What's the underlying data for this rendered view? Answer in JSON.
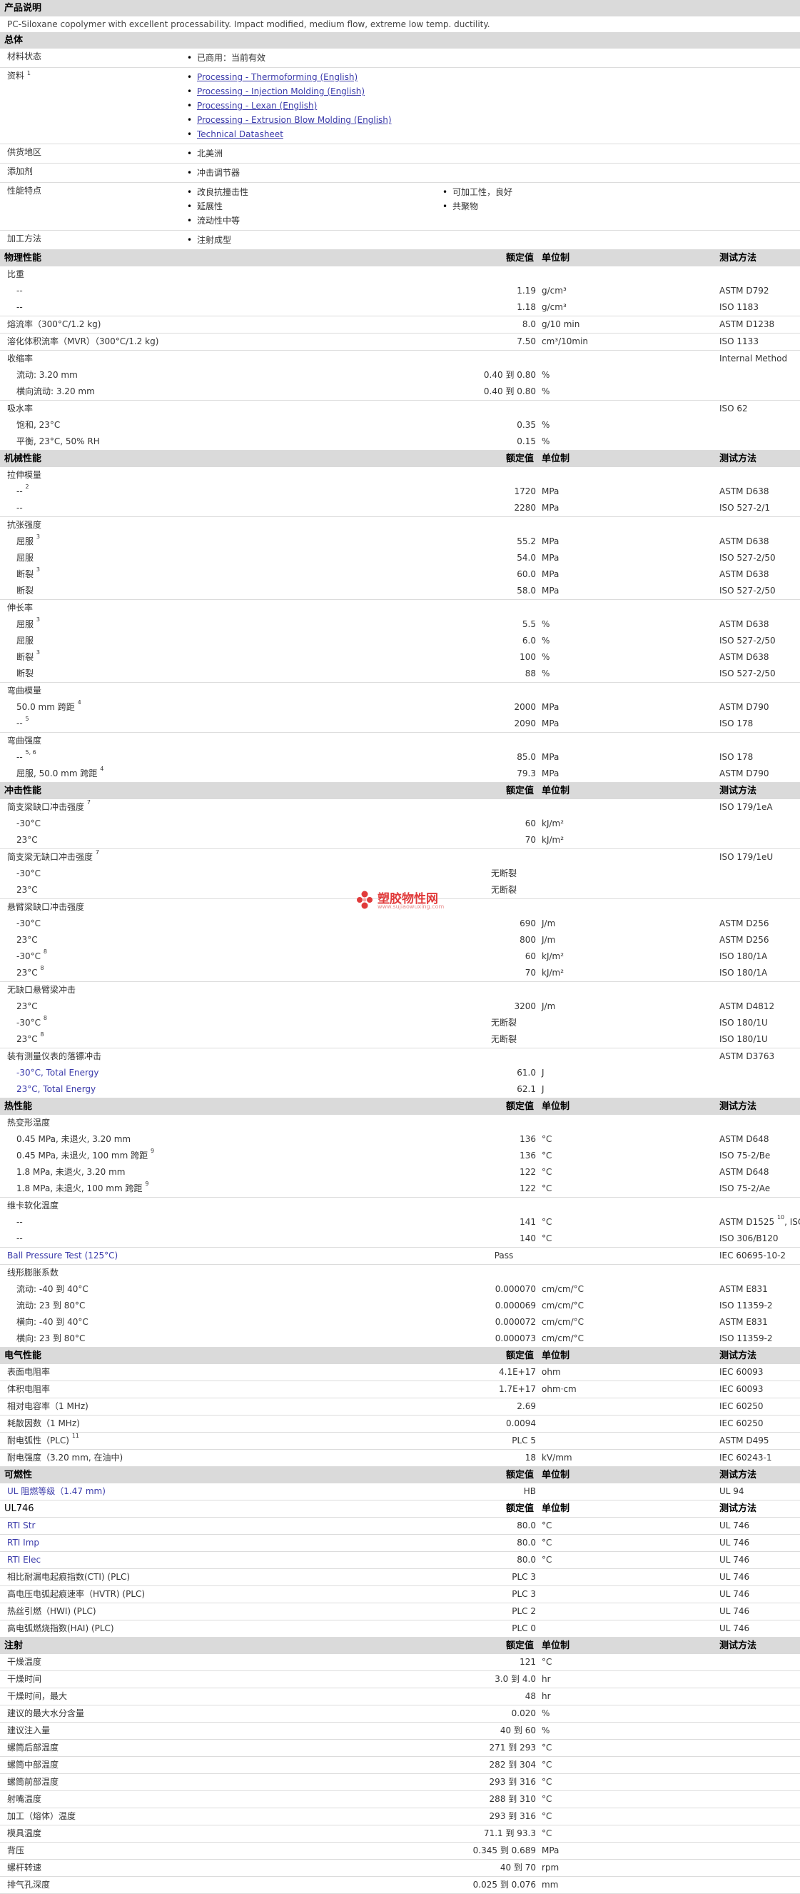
{
  "product_desc": {
    "title": "产品说明",
    "text": "PC-Siloxane copolymer with excellent processability. Impact modified, medium flow, extreme low temp. ductility."
  },
  "general": {
    "title": "总体",
    "rows": [
      {
        "label": "材料状态",
        "items": [
          "已商用：当前有效"
        ]
      },
      {
        "label": "资料",
        "sup": "1",
        "links": [
          "Processing - Thermoforming (English)",
          "Processing - Injection Molding (English)",
          "Processing - Lexan (English)",
          "Processing - Extrusion Blow Molding (English)",
          "Technical Datasheet"
        ]
      },
      {
        "label": "供货地区",
        "items": [
          "北美洲"
        ]
      },
      {
        "label": "添加剂",
        "items": [
          "冲击调节器"
        ]
      },
      {
        "label": "性能特点",
        "items": [
          "改良抗撞击性",
          "可加工性，良好",
          "延展性",
          "共聚物",
          "流动性中等"
        ]
      },
      {
        "label": "加工方法",
        "items": [
          "注射成型"
        ]
      }
    ]
  },
  "headers": {
    "nominal": "额定值",
    "unit": "单位制",
    "method": "测试方法"
  },
  "sections": [
    {
      "title": "物理性能",
      "groups": [
        {
          "label": "比重",
          "rows": [
            {
              "label": "--",
              "val": "1.19",
              "unit": "g/cm³",
              "mth": "ASTM D792"
            },
            {
              "label": "--",
              "val": "1.18",
              "unit": "g/cm³",
              "mth": "ISO 1183"
            }
          ]
        },
        {
          "rows": [
            {
              "label": "熔流率（300°C/1.2 kg)",
              "top": true,
              "val": "8.0",
              "unit": "g/10 min",
              "mth": "ASTM D1238"
            }
          ]
        },
        {
          "rows": [
            {
              "label": "溶化体积流率（MVR）（300°C/1.2 kg)",
              "top": true,
              "val": "7.50",
              "unit": "cm³/10min",
              "mth": "ISO 1133"
            }
          ]
        },
        {
          "label": "收缩率",
          "labelmth": "Internal Method",
          "rows": [
            {
              "label": "流动: 3.20 mm",
              "val": "0.40 到  0.80",
              "unit": "%",
              "mth": ""
            },
            {
              "label": "横向流动: 3.20 mm",
              "val": "0.40 到  0.80",
              "unit": "%",
              "mth": ""
            }
          ]
        },
        {
          "label": "吸水率",
          "labelmth": "ISO 62",
          "rows": [
            {
              "label": "饱和, 23°C",
              "val": "0.35",
              "unit": "%",
              "mth": ""
            },
            {
              "label": "平衡, 23°C, 50% RH",
              "val": "0.15",
              "unit": "%",
              "mth": ""
            }
          ]
        }
      ]
    },
    {
      "title": "机械性能",
      "groups": [
        {
          "label": "拉伸模量",
          "rows": [
            {
              "label": "--",
              "sup": "2",
              "val": "1720",
              "unit": "MPa",
              "mth": "ASTM D638"
            },
            {
              "label": "--",
              "val": "2280",
              "unit": "MPa",
              "mth": "ISO 527-2/1"
            }
          ]
        },
        {
          "label": "抗张强度",
          "rows": [
            {
              "label": "屈服",
              "sup": "3",
              "val": "55.2",
              "unit": "MPa",
              "mth": "ASTM D638"
            },
            {
              "label": "屈服",
              "val": "54.0",
              "unit": "MPa",
              "mth": "ISO 527-2/50"
            },
            {
              "label": "断裂",
              "sup": "3",
              "val": "60.0",
              "unit": "MPa",
              "mth": "ASTM D638"
            },
            {
              "label": "断裂",
              "val": "58.0",
              "unit": "MPa",
              "mth": "ISO 527-2/50"
            }
          ]
        },
        {
          "label": "伸长率",
          "rows": [
            {
              "label": "屈服",
              "sup": "3",
              "val": "5.5",
              "unit": "%",
              "mth": "ASTM D638"
            },
            {
              "label": "屈服",
              "val": "6.0",
              "unit": "%",
              "mth": "ISO 527-2/50"
            },
            {
              "label": "断裂",
              "sup": "3",
              "val": "100",
              "unit": "%",
              "mth": "ASTM D638"
            },
            {
              "label": "断裂",
              "val": "88",
              "unit": "%",
              "mth": "ISO 527-2/50"
            }
          ]
        },
        {
          "label": "弯曲模量",
          "rows": [
            {
              "label": "50.0 mm 跨距",
              "sup": "4",
              "val": "2000",
              "unit": "MPa",
              "mth": "ASTM D790"
            },
            {
              "label": "--",
              "sup": "5",
              "val": "2090",
              "unit": "MPa",
              "mth": "ISO 178"
            }
          ]
        },
        {
          "label": "弯曲强度",
          "rows": [
            {
              "label": "--",
              "sup": "5, 6",
              "val": "85.0",
              "unit": "MPa",
              "mth": "ISO 178"
            },
            {
              "label": "屈服, 50.0 mm 跨距",
              "sup": "4",
              "val": "79.3",
              "unit": "MPa",
              "mth": "ASTM D790"
            }
          ]
        }
      ]
    },
    {
      "title": "冲击性能",
      "groups": [
        {
          "label": "简支梁缺口冲击强度",
          "labelsup": "7",
          "labelmth": "ISO 179/1eA",
          "rows": [
            {
              "label": "-30°C",
              "val": "60",
              "unit": "kJ/m²",
              "mth": ""
            },
            {
              "label": "23°C",
              "val": "70",
              "unit": "kJ/m²",
              "mth": ""
            }
          ]
        },
        {
          "label": "简支梁无缺口冲击强度",
          "labelsup": "7",
          "labelmth": "ISO 179/1eU",
          "rows": [
            {
              "label": "-30°C",
              "val": "无断裂",
              "center": true,
              "unit": "",
              "mth": ""
            },
            {
              "label": "23°C",
              "val": "无断裂",
              "center": true,
              "unit": "",
              "mth": ""
            }
          ]
        },
        {
          "label": "悬臂梁缺口冲击强度",
          "rows": [
            {
              "label": "-30°C",
              "val": "690",
              "unit": "J/m",
              "mth": "ASTM D256"
            },
            {
              "label": "23°C",
              "val": "800",
              "unit": "J/m",
              "mth": "ASTM D256"
            },
            {
              "label": "-30°C",
              "sup": "8",
              "val": "60",
              "unit": "kJ/m²",
              "mth": "ISO 180/1A"
            },
            {
              "label": "23°C",
              "sup": "8",
              "val": "70",
              "unit": "kJ/m²",
              "mth": "ISO 180/1A"
            }
          ]
        },
        {
          "label": "无缺口悬臂梁冲击",
          "rows": [
            {
              "label": "23°C",
              "val": "3200",
              "unit": "J/m",
              "mth": "ASTM D4812"
            },
            {
              "label": "-30°C",
              "sup": "8",
              "val": "无断裂",
              "center": true,
              "unit": "",
              "mth": "ISO 180/1U"
            },
            {
              "label": "23°C",
              "sup": "8",
              "val": "无断裂",
              "center": true,
              "unit": "",
              "mth": "ISO 180/1U"
            }
          ]
        },
        {
          "label": "装有测量仪表的落镖冲击",
          "labelmth": "ASTM D3763",
          "rows": [
            {
              "label": "-30°C, Total Energy",
              "link": true,
              "val": "61.0",
              "unit": "J",
              "mth": ""
            },
            {
              "label": "23°C, Total Energy",
              "link": true,
              "val": "62.1",
              "unit": "J",
              "mth": ""
            }
          ]
        }
      ]
    },
    {
      "title": "热性能",
      "groups": [
        {
          "label": "热变形温度",
          "rows": [
            {
              "label": "0.45 MPa, 未退火, 3.20 mm",
              "val": "136",
              "unit": "°C",
              "mth": "ASTM D648"
            },
            {
              "label": "0.45 MPa, 未退火, 100 mm 跨距",
              "sup": "9",
              "val": "136",
              "unit": "°C",
              "mth": "ISO 75-2/Be"
            },
            {
              "label": "1.8 MPa, 未退火, 3.20 mm",
              "val": "122",
              "unit": "°C",
              "mth": "ASTM D648"
            },
            {
              "label": "1.8 MPa, 未退火, 100 mm 跨距",
              "sup": "9",
              "val": "122",
              "unit": "°C",
              "mth": "ISO 75-2/Ae"
            }
          ]
        },
        {
          "label": "维卡软化温度",
          "rows": [
            {
              "label": "--",
              "val": "141",
              "unit": "°C",
              "mth": "ASTM D1525",
              "mthsup": "10",
              "mthtail": ", ISO"
            },
            {
              "label": "--",
              "val": "140",
              "unit": "°C",
              "mth": "ISO 306/B120"
            }
          ]
        },
        {
          "rows": [
            {
              "label": "Ball Pressure Test (125°C)",
              "top": true,
              "link": true,
              "val": "Pass",
              "center": true,
              "unit": "",
              "mth": "IEC 60695-10-2"
            }
          ]
        },
        {
          "label": "线形膨胀系数",
          "rows": [
            {
              "label": "流动: -40 到  40°C",
              "val": "0.000070",
              "unit": "cm/cm/°C",
              "mth": "ASTM E831"
            },
            {
              "label": "流动: 23 到  80°C",
              "val": "0.000069",
              "unit": "cm/cm/°C",
              "mth": "ISO 11359-2"
            },
            {
              "label": "横向: -40 到  40°C",
              "val": "0.000072",
              "unit": "cm/cm/°C",
              "mth": "ASTM E831"
            },
            {
              "label": "横向: 23 到  80°C",
              "val": "0.000073",
              "unit": "cm/cm/°C",
              "mth": "ISO 11359-2"
            }
          ]
        }
      ]
    },
    {
      "title": "电气性能",
      "groups": [
        {
          "rows": [
            {
              "label": "表面电阻率",
              "top": true,
              "val": "4.1E+17",
              "unit": "ohm",
              "mth": "IEC 60093"
            }
          ]
        },
        {
          "rows": [
            {
              "label": "体积电阻率",
              "top": true,
              "val": "1.7E+17",
              "unit": "ohm·cm",
              "mth": "IEC 60093"
            }
          ]
        },
        {
          "rows": [
            {
              "label": "相对电容率（1 MHz)",
              "top": true,
              "val": "2.69",
              "unit": "",
              "mth": "IEC 60250"
            }
          ]
        },
        {
          "rows": [
            {
              "label": "耗散因数（1 MHz)",
              "top": true,
              "val": "0.0094",
              "unit": "",
              "mth": "IEC 60250"
            }
          ]
        },
        {
          "rows": [
            {
              "label": "耐电弧性（PLC)",
              "sup": "11",
              "top": true,
              "val": "PLC 5",
              "unit": "",
              "mth": "ASTM D495"
            }
          ]
        },
        {
          "rows": [
            {
              "label": "耐电强度（3.20 mm, 在油中)",
              "top": true,
              "val": "18",
              "unit": "kV/mm",
              "mth": "IEC 60243-1"
            }
          ]
        }
      ]
    },
    {
      "title": "可燃性",
      "groups": [
        {
          "rows": [
            {
              "label": "UL 阻燃等级（1.47 mm)",
              "top": true,
              "link": true,
              "val": "HB",
              "unit": "",
              "mth": "UL 94"
            }
          ]
        }
      ]
    },
    {
      "title": "UL746",
      "plain": true,
      "groups": [
        {
          "rows": [
            {
              "label": "RTI Str",
              "top": true,
              "link": true,
              "val": "80.0",
              "unit": "°C",
              "mth": "UL 746"
            }
          ]
        },
        {
          "rows": [
            {
              "label": "RTI Imp",
              "top": true,
              "link": true,
              "val": "80.0",
              "unit": "°C",
              "mth": "UL 746"
            }
          ]
        },
        {
          "rows": [
            {
              "label": "RTI Elec",
              "top": true,
              "link": true,
              "val": "80.0",
              "unit": "°C",
              "mth": "UL 746"
            }
          ]
        },
        {
          "rows": [
            {
              "label": "相比耐漏电起痕指数(CTI) (PLC)",
              "top": true,
              "val": "PLC 3",
              "unit": "",
              "mth": "UL 746"
            }
          ]
        },
        {
          "rows": [
            {
              "label": "高电压电弧起痕速率（HVTR) (PLC)",
              "top": true,
              "val": "PLC 3",
              "unit": "",
              "mth": "UL 746"
            }
          ]
        },
        {
          "rows": [
            {
              "label": "热丝引燃（HWI) (PLC)",
              "top": true,
              "val": "PLC 2",
              "unit": "",
              "mth": "UL 746"
            }
          ]
        },
        {
          "rows": [
            {
              "label": "高电弧燃烧指数(HAI) (PLC)",
              "top": true,
              "val": "PLC 0",
              "unit": "",
              "mth": "UL 746"
            }
          ]
        }
      ]
    },
    {
      "title": "注射",
      "groups": [
        {
          "rows": [
            {
              "label": "干燥温度",
              "top": true,
              "val": "121",
              "unit": "°C",
              "mth": ""
            }
          ]
        },
        {
          "rows": [
            {
              "label": "干燥时间",
              "top": true,
              "val": "3.0 到  4.0",
              "unit": "hr",
              "mth": ""
            }
          ]
        },
        {
          "rows": [
            {
              "label": "干燥时间，最大",
              "top": true,
              "val": "48",
              "unit": "hr",
              "mth": ""
            }
          ]
        },
        {
          "rows": [
            {
              "label": "建议的最大水分含量",
              "top": true,
              "val": "0.020",
              "unit": "%",
              "mth": ""
            }
          ]
        },
        {
          "rows": [
            {
              "label": "建议注入量",
              "top": true,
              "val": "40 到  60",
              "unit": "%",
              "mth": ""
            }
          ]
        },
        {
          "rows": [
            {
              "label": "螺筒后部温度",
              "top": true,
              "val": "271 到  293",
              "unit": "°C",
              "mth": ""
            }
          ]
        },
        {
          "rows": [
            {
              "label": "螺筒中部温度",
              "top": true,
              "val": "282 到  304",
              "unit": "°C",
              "mth": ""
            }
          ]
        },
        {
          "rows": [
            {
              "label": "螺筒前部温度",
              "top": true,
              "val": "293 到  316",
              "unit": "°C",
              "mth": ""
            }
          ]
        },
        {
          "rows": [
            {
              "label": "射嘴温度",
              "top": true,
              "val": "288 到  310",
              "unit": "°C",
              "mth": ""
            }
          ]
        },
        {
          "rows": [
            {
              "label": "加工（熔体）温度",
              "top": true,
              "val": "293 到  316",
              "unit": "°C",
              "mth": ""
            }
          ]
        },
        {
          "rows": [
            {
              "label": "模具温度",
              "top": true,
              "val": "71.1 到  93.3",
              "unit": "°C",
              "mth": ""
            }
          ]
        },
        {
          "rows": [
            {
              "label": "背压",
              "top": true,
              "val": "0.345 到  0.689",
              "unit": "MPa",
              "mth": ""
            }
          ]
        },
        {
          "rows": [
            {
              "label": "螺杆转速",
              "top": true,
              "val": "40 到  70",
              "unit": "rpm",
              "mth": ""
            }
          ]
        },
        {
          "rows": [
            {
              "label": "排气孔深度",
              "top": true,
              "val": "0.025 到  0.076",
              "unit": "mm",
              "mth": ""
            }
          ]
        }
      ]
    }
  ],
  "watermark": {
    "cn": "塑胶物性网",
    "en": "www.sujiaowuxing.com",
    "color": "#e13b3b"
  }
}
